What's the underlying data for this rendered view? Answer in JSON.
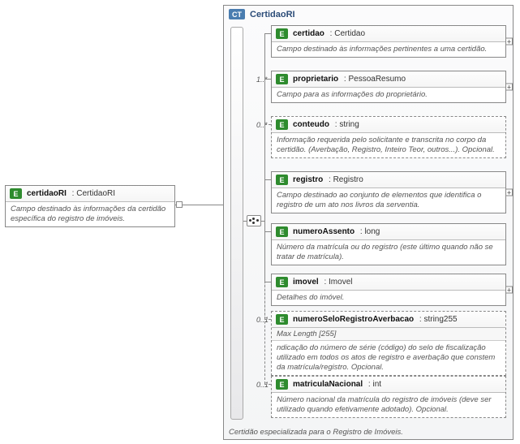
{
  "root": {
    "badge": "E",
    "name": "certidaoRI",
    "type": "CertidaoRI",
    "desc": "Campo destinado às informações da certidão específica do registro de imóveis."
  },
  "ct": {
    "badge": "CT",
    "title": "CertidaoRI",
    "footer": "Certidão especializada para o Registro de Imóveis."
  },
  "children": [
    {
      "badge": "E",
      "name": "certidao",
      "type": "Certidao",
      "desc": "Campo destinado às informações pertinentes a uma certidão.",
      "mult": "",
      "optional": false,
      "expand": true,
      "constraint": ""
    },
    {
      "badge": "E",
      "name": "proprietario",
      "type": "PessoaResumo",
      "desc": "Campo para as informações do proprietário.",
      "mult": "1..*",
      "optional": false,
      "expand": true,
      "constraint": ""
    },
    {
      "badge": "E",
      "name": "conteudo",
      "type": "string",
      "desc": "Informação requerida pelo solicitante e transcrita no corpo da certidão. (Averbação, Registro, Inteiro Teor, outros...). Opcional.",
      "mult": "0..*",
      "optional": true,
      "expand": false,
      "constraint": ""
    },
    {
      "badge": "E",
      "name": "registro",
      "type": "Registro",
      "desc": "Campo destinado ao conjunto de elementos que identifica o registro de um ato nos livros da serventia.",
      "mult": "",
      "optional": false,
      "expand": true,
      "constraint": ""
    },
    {
      "badge": "E",
      "name": "numeroAssento",
      "type": "long",
      "desc": "Número da matrícula ou do registro (este último quando não se tratar de matrícula).",
      "mult": "",
      "optional": false,
      "expand": false,
      "constraint": ""
    },
    {
      "badge": "E",
      "name": "imovel",
      "type": "Imovel",
      "desc": "Detalhes do imóvel.",
      "mult": "",
      "optional": false,
      "expand": true,
      "constraint": ""
    },
    {
      "badge": "E",
      "name": "numeroSeloRegistroAverbacao",
      "type": "string255",
      "desc": "ndicação do número de série (código) do selo de fiscalização utilizado em todos os atos de registro e averbação que constem da matrícula/registro. Opcional.",
      "mult": "0..1",
      "optional": true,
      "expand": false,
      "constraint": "Max Length    [255]"
    },
    {
      "badge": "E",
      "name": "matriculaNacional",
      "type": "int",
      "desc": "Número nacional da matrícula do registro de imóveis (deve ser utilizado quando efetivamente adotado). Opcional.",
      "mult": "0..1",
      "optional": true,
      "expand": false,
      "constraint": ""
    }
  ]
}
